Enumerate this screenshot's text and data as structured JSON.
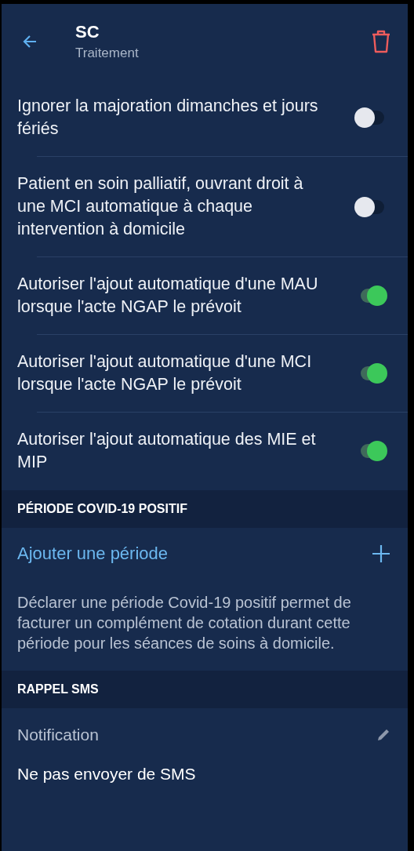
{
  "header": {
    "title": "SC",
    "subtitle": "Traitement"
  },
  "settings": [
    {
      "label": "Ignorer la majoration dimanches et jours fériés",
      "on": false
    },
    {
      "label": "Patient en soin palliatif, ouvrant droit à une MCI automatique à chaque intervention à domicile",
      "on": false
    },
    {
      "label": "Autoriser l'ajout automatique d'une MAU lorsque l'acte NGAP le prévoit",
      "on": true
    },
    {
      "label": "Autoriser l'ajout automatique d'une MCI lorsque l'acte NGAP le prévoit",
      "on": true
    },
    {
      "label": "Autoriser l'ajout automatique des MIE et MIP",
      "on": true
    }
  ],
  "covid_section": {
    "title": "PÉRIODE COVID-19 POSITIF",
    "add_label": "Ajouter une période",
    "description": "Déclarer une période Covid-19 positif permet de facturer un complément de cotation durant cette période pour les séances de soins à domicile."
  },
  "sms_section": {
    "title": "RAPPEL SMS",
    "field_label": "Notification",
    "field_value": "Ne pas envoyer de SMS"
  }
}
